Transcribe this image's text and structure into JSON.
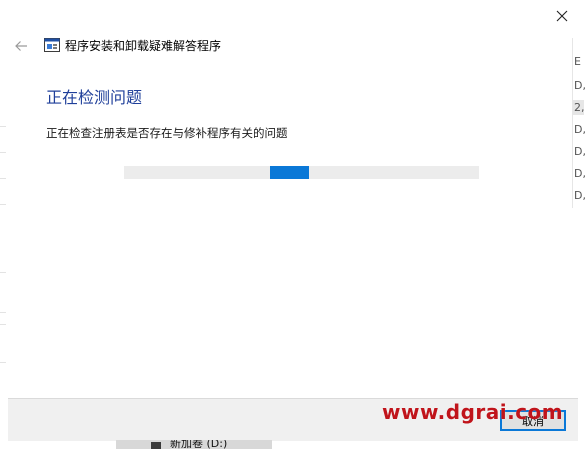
{
  "window": {
    "title": "程序安装和卸载疑难解答程序",
    "close_icon": "close-icon",
    "back_icon": "back-arrow-icon"
  },
  "main": {
    "heading": "正在检测问题",
    "status": "正在检查注册表是否存在与修补程序有关的问题",
    "progress": {
      "mode": "indeterminate",
      "chunk_start_fraction": 0.41,
      "chunk_end_fraction": 0.52
    }
  },
  "footer": {
    "cancel_label": "取消"
  },
  "watermark": {
    "text": "www.dgrai.com"
  },
  "background": {
    "drive_label": "新加卷 (D:)",
    "right_fragments": [
      "E",
      "D,",
      "2,",
      "D,",
      "D,",
      "D,",
      "D,"
    ]
  },
  "colors": {
    "accent": "#0a78d7",
    "heading": "#1f3f9a",
    "watermark": "#c0141b",
    "footer_bg": "#f0f0f0",
    "progress_track": "#ececec"
  }
}
